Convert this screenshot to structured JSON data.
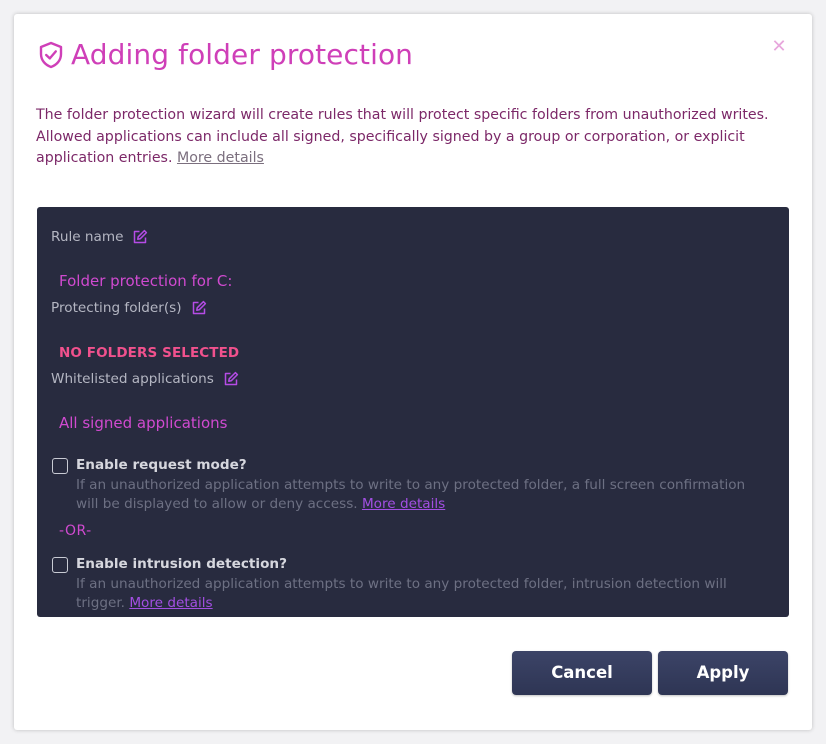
{
  "dialog": {
    "title": "Adding folder protection",
    "title_icon": "shield-check-icon",
    "close_icon": "close-icon",
    "close_glyph": "✕",
    "intro": "The folder protection wizard will create rules that will protect specific folders from unauthorized writes. Allowed applications can include all signed, specifically signed by a group or corporation, or explicit application entries.",
    "intro_link": "More details"
  },
  "form": {
    "rule_name": {
      "label": "Rule name",
      "value": "Folder protection for C:",
      "edit_icon": "edit-icon"
    },
    "folders": {
      "label": "Protecting folder(s)",
      "value": "NO FOLDERS SELECTED",
      "edit_icon": "edit-icon"
    },
    "apps": {
      "label": "Whitelisted applications",
      "value": "All signed applications",
      "edit_icon": "edit-icon"
    },
    "request_mode": {
      "label": "Enable request mode?",
      "checked": false,
      "description": "If an unauthorized application attempts to write to any protected folder, a full screen confirmation will be displayed to allow or deny access.",
      "link": "More details"
    },
    "or_text": "-OR-",
    "intrusion": {
      "label": "Enable intrusion detection?",
      "checked": false,
      "description": "If an unauthorized application attempts to write to any protected folder, intrusion detection will trigger.",
      "link": "More details"
    }
  },
  "buttons": {
    "cancel": "Cancel",
    "apply": "Apply"
  },
  "colors": {
    "accent": "#cf3fb8",
    "panel_bg": "#282b3f",
    "warning": "#f1518d",
    "link": "#a34fe3",
    "button_bg": "#353d5e"
  }
}
